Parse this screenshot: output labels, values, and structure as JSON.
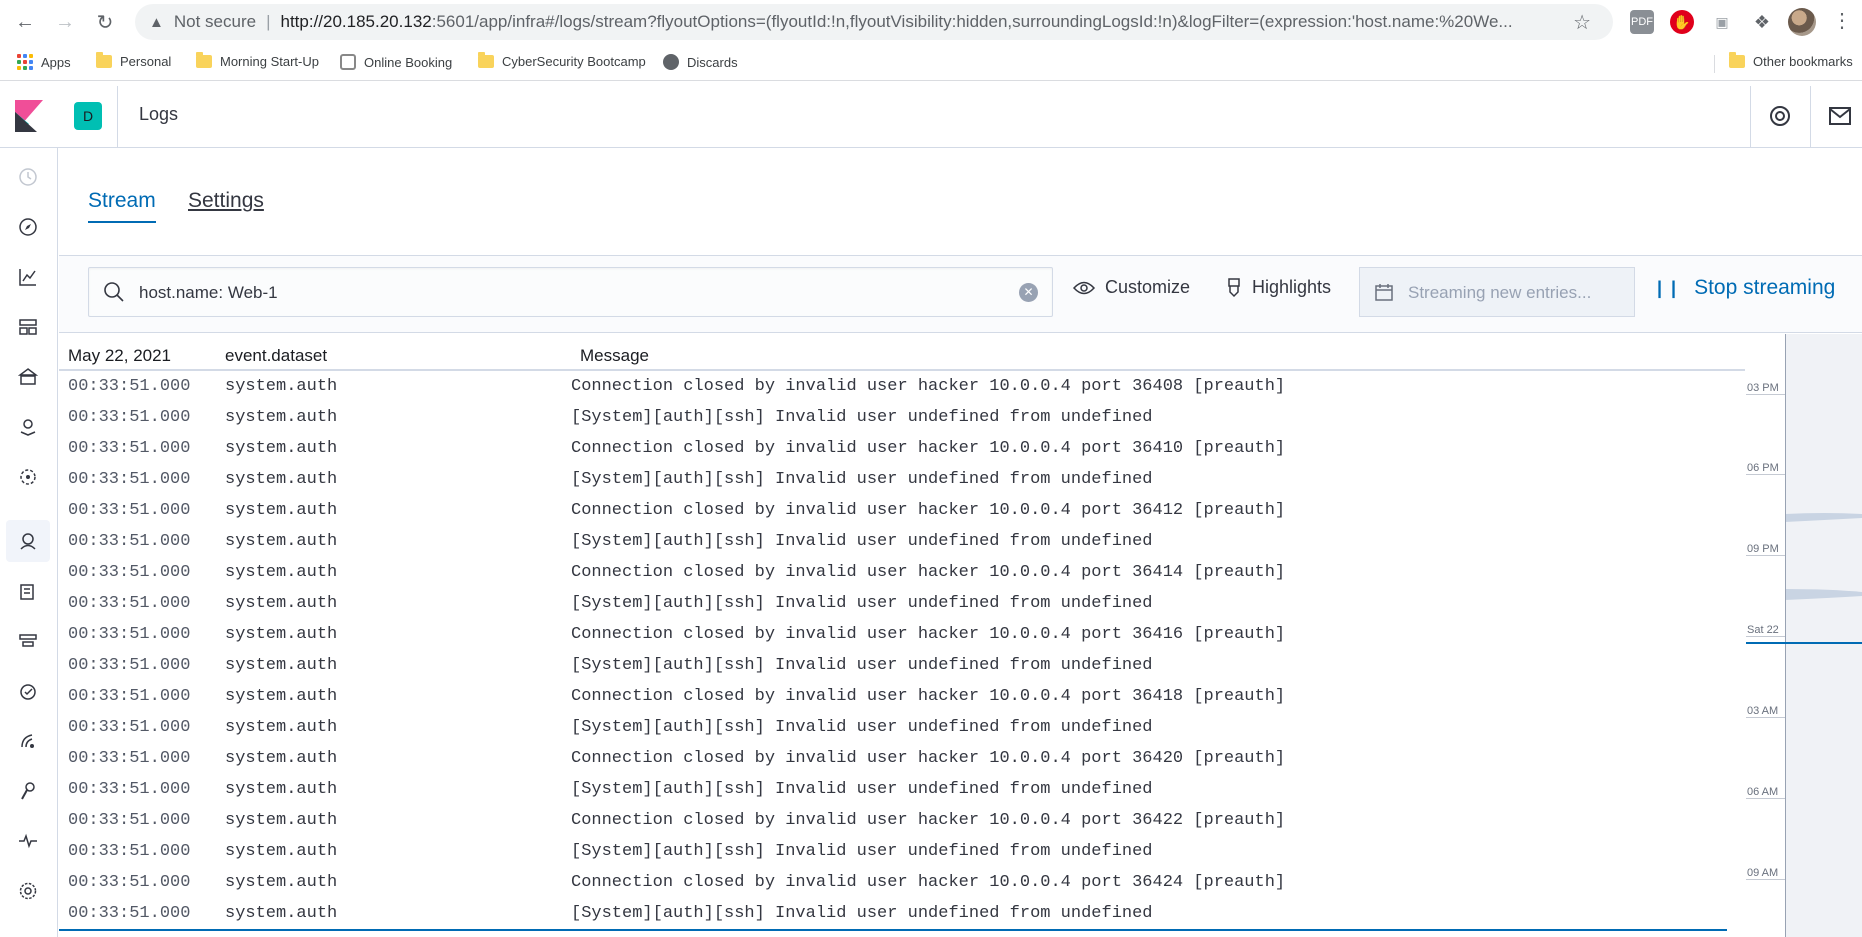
{
  "browser": {
    "not_secure": "Not secure",
    "url_host": "http://20.185.20.132",
    "url_rest": ":5601/app/infra#/logs/stream?flyoutOptions=(flyoutId:!n,flyoutVisibility:hidden,surroundingLogsId:!n)&logFilter=(expression:'host.name:%20We..."
  },
  "bookmarks": {
    "items": [
      "Apps",
      "Personal",
      "Morning Start-Up",
      "Online Booking",
      "CyberSecurity Bootcamp",
      "Discards"
    ],
    "other": "Other bookmarks"
  },
  "header": {
    "space_initial": "D",
    "app_title": "Logs"
  },
  "tabs": {
    "stream": "Stream",
    "settings": "Settings"
  },
  "toolbar": {
    "search_value": "host.name: Web-1",
    "customize": "Customize",
    "highlights": "Highlights",
    "streaming_placeholder": "Streaming new entries...",
    "stop_streaming": "Stop streaming"
  },
  "log_table": {
    "headers": {
      "date": "May 22, 2021",
      "dataset": "event.dataset",
      "message": "Message"
    },
    "rows": [
      {
        "time": "00:33:51.000",
        "dataset": "system.auth",
        "message": "Connection closed by invalid user hacker 10.0.0.4 port 36408 [preauth]"
      },
      {
        "time": "00:33:51.000",
        "dataset": "system.auth",
        "message": "[System][auth][ssh] Invalid user undefined from undefined"
      },
      {
        "time": "00:33:51.000",
        "dataset": "system.auth",
        "message": "Connection closed by invalid user hacker 10.0.0.4 port 36410 [preauth]"
      },
      {
        "time": "00:33:51.000",
        "dataset": "system.auth",
        "message": "[System][auth][ssh] Invalid user undefined from undefined"
      },
      {
        "time": "00:33:51.000",
        "dataset": "system.auth",
        "message": "Connection closed by invalid user hacker 10.0.0.4 port 36412 [preauth]"
      },
      {
        "time": "00:33:51.000",
        "dataset": "system.auth",
        "message": "[System][auth][ssh] Invalid user undefined from undefined"
      },
      {
        "time": "00:33:51.000",
        "dataset": "system.auth",
        "message": "Connection closed by invalid user hacker 10.0.0.4 port 36414 [preauth]"
      },
      {
        "time": "00:33:51.000",
        "dataset": "system.auth",
        "message": "[System][auth][ssh] Invalid user undefined from undefined"
      },
      {
        "time": "00:33:51.000",
        "dataset": "system.auth",
        "message": "Connection closed by invalid user hacker 10.0.0.4 port 36416 [preauth]"
      },
      {
        "time": "00:33:51.000",
        "dataset": "system.auth",
        "message": "[System][auth][ssh] Invalid user undefined from undefined"
      },
      {
        "time": "00:33:51.000",
        "dataset": "system.auth",
        "message": "Connection closed by invalid user hacker 10.0.0.4 port 36418 [preauth]"
      },
      {
        "time": "00:33:51.000",
        "dataset": "system.auth",
        "message": "[System][auth][ssh] Invalid user undefined from undefined"
      },
      {
        "time": "00:33:51.000",
        "dataset": "system.auth",
        "message": "Connection closed by invalid user hacker 10.0.0.4 port 36420 [preauth]"
      },
      {
        "time": "00:33:51.000",
        "dataset": "system.auth",
        "message": "[System][auth][ssh] Invalid user undefined from undefined"
      },
      {
        "time": "00:33:51.000",
        "dataset": "system.auth",
        "message": "Connection closed by invalid user hacker 10.0.0.4 port 36422 [preauth]"
      },
      {
        "time": "00:33:51.000",
        "dataset": "system.auth",
        "message": "[System][auth][ssh] Invalid user undefined from undefined"
      },
      {
        "time": "00:33:51.000",
        "dataset": "system.auth",
        "message": "Connection closed by invalid user hacker 10.0.0.4 port 36424 [preauth]"
      },
      {
        "time": "00:33:51.000",
        "dataset": "system.auth",
        "message": "[System][auth][ssh] Invalid user undefined from undefined"
      }
    ]
  },
  "minimap": {
    "labels": [
      "03 PM",
      "06 PM",
      "09 PM",
      "Sat 22",
      "03 AM",
      "06 AM",
      "09 AM"
    ]
  },
  "colors": {
    "accent": "#006bb4",
    "space_badge": "#00bfb3",
    "border": "#d3dae6"
  }
}
